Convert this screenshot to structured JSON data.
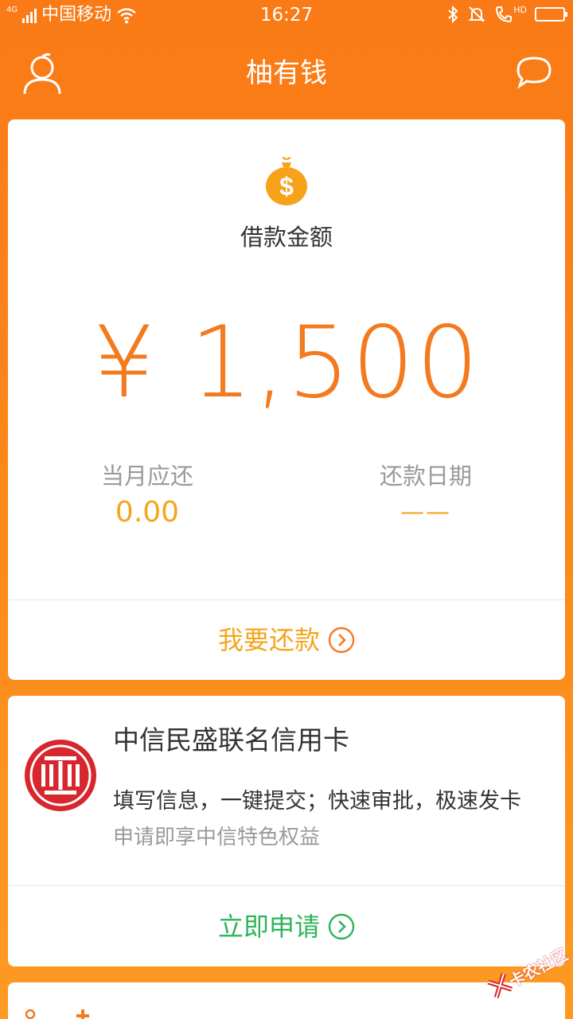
{
  "status_bar": {
    "network": "4G",
    "carrier": "中国移动",
    "time": "16:27",
    "hd": "HD",
    "icons": [
      "signal-icon",
      "wifi-icon",
      "bluetooth-icon",
      "mute-bell-icon",
      "call-icon",
      "battery-icon"
    ]
  },
  "nav": {
    "title": "柚有钱",
    "left_icon": "user-icon",
    "right_icon": "chat-icon"
  },
  "loan_card": {
    "icon": "money-bag-icon",
    "label": "借款金额",
    "amount": "¥ 1,500",
    "monthly_label": "当月应还",
    "monthly_value": "0.00",
    "date_label": "还款日期",
    "date_value": "——",
    "action_label": "我要还款",
    "accent": "#f47a20"
  },
  "credit_card": {
    "logo": "citic-logo",
    "title": "中信民盛联名信用卡",
    "description": "填写信息，一键提交；快速审批，极速发卡",
    "sub": "申请即享中信特色权益",
    "action_label": "立即申请",
    "accent": "#2fb35a"
  },
  "watermark": {
    "text": "卡农社区"
  },
  "colors": {
    "background_top": "#f97a16",
    "background_bottom": "#fd9a22",
    "repay": "#f4a51e",
    "citic_red": "#d7262d"
  }
}
